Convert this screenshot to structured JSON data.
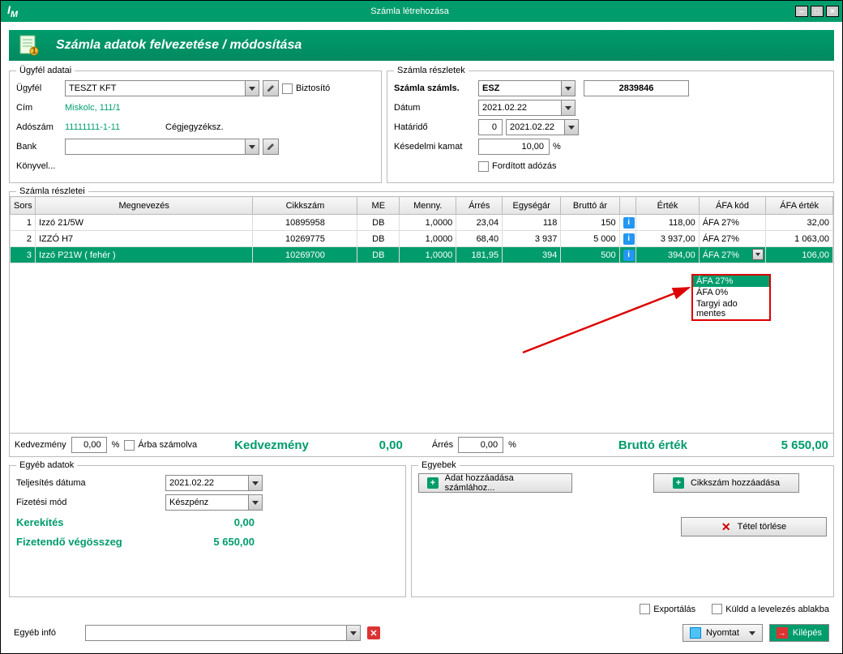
{
  "window": {
    "title": "Számla létrehozása"
  },
  "header": {
    "text": "Számla adatok felvezetése / módosítása"
  },
  "customer": {
    "legend": "Ügyfél adatai",
    "ugyfel_label": "Ügyfél",
    "ugyfel_value": "TESZT KFT",
    "biztosito_label": "Biztosító",
    "cim_label": "Cím",
    "cim_value": "Miskolc, 111/1",
    "adoszam_label": "Adószám",
    "adoszam_value": "11111111-1-11",
    "cegjegyzek_label": "Cégjegyzéksz.",
    "bank_label": "Bank",
    "konyvel_label": "Könyvel..."
  },
  "invoice": {
    "legend": "Számla részletek",
    "szamla_label": "Számla számls.",
    "prefix": "ESZ",
    "number": "2839846",
    "datum_label": "Dátum",
    "datum_value": "2021.02.22",
    "hatarido_label": "Határidő",
    "hatarido_days": "0",
    "hatarido_date": "2021.02.22",
    "kamat_label": "Késedelmi kamat",
    "kamat_value": "10,00",
    "kamat_unit": "%",
    "forditott_label": "Fordított adózás"
  },
  "details": {
    "legend": "Számla részletei",
    "cols": [
      "Sors",
      "Megnevezés",
      "Cikkszám",
      "ME",
      "Menny.",
      "Árrés",
      "Egységár",
      "Bruttó ár",
      "",
      "Érték",
      "ÁFA kód",
      "ÁFA érték"
    ],
    "rows": [
      {
        "n": "1",
        "name": "Izzó 21/5W",
        "code": "10895958",
        "me": "DB",
        "qty": "1,0000",
        "marg": "23,04",
        "unit": "118",
        "gross": "150",
        "val": "118,00",
        "afa": "ÁFA 27%",
        "afav": "32,00"
      },
      {
        "n": "2",
        "name": "IZZÓ H7",
        "code": "10269775",
        "me": "DB",
        "qty": "1,0000",
        "marg": "68,40",
        "unit": "3 937",
        "gross": "5 000",
        "val": "3 937,00",
        "afa": "ÁFA 27%",
        "afav": "1 063,00"
      },
      {
        "n": "3",
        "name": "Izzó P21W ( fehér )",
        "code": "10269700",
        "me": "DB",
        "qty": "1,0000",
        "marg": "181,95",
        "unit": "394",
        "gross": "500",
        "val": "394,00",
        "afa": "ÁFA 27%",
        "afav": "106,00"
      }
    ]
  },
  "afa_options": [
    "ÁFA 27%",
    "ÁFA 0%",
    "Targyi ado mentes"
  ],
  "summary": {
    "kedv_label": "Kedvezmény",
    "kedv_val": "0,00",
    "kedv_unit": "%",
    "arba_label": "Árba számolva",
    "kedv_big_label": "Kedvezmény",
    "kedv_big_val": "0,00",
    "arres_label": "Árrés",
    "arres_val": "0,00",
    "arres_unit": "%",
    "brutto_label": "Bruttó érték",
    "brutto_val": "5 650,00"
  },
  "egyeb_adatok": {
    "legend": "Egyéb adatok",
    "telj_label": "Teljesítés dátuma",
    "telj_val": "2021.02.22",
    "fiz_label": "Fizetési mód",
    "fiz_val": "Készpénz",
    "kerek_label": "Kerekítés",
    "kerek_val": "0,00",
    "fizetendo_label": "Fizetendő végösszeg",
    "fizetendo_val": "5 650,00"
  },
  "egyebek": {
    "legend": "Egyebek",
    "adat_btn": "Adat hozzáadása számlához...",
    "cikk_btn": "Cikkszám hozzáadása",
    "tetel_btn": "Tétel törlése"
  },
  "footer": {
    "export_label": "Exportálás",
    "kuldd_label": "Küldd a levelezés ablakba",
    "egyeb_info_label": "Egyéb infó",
    "nyomtat_label": "Nyomtat",
    "kilepes_label": "Kilépés"
  }
}
